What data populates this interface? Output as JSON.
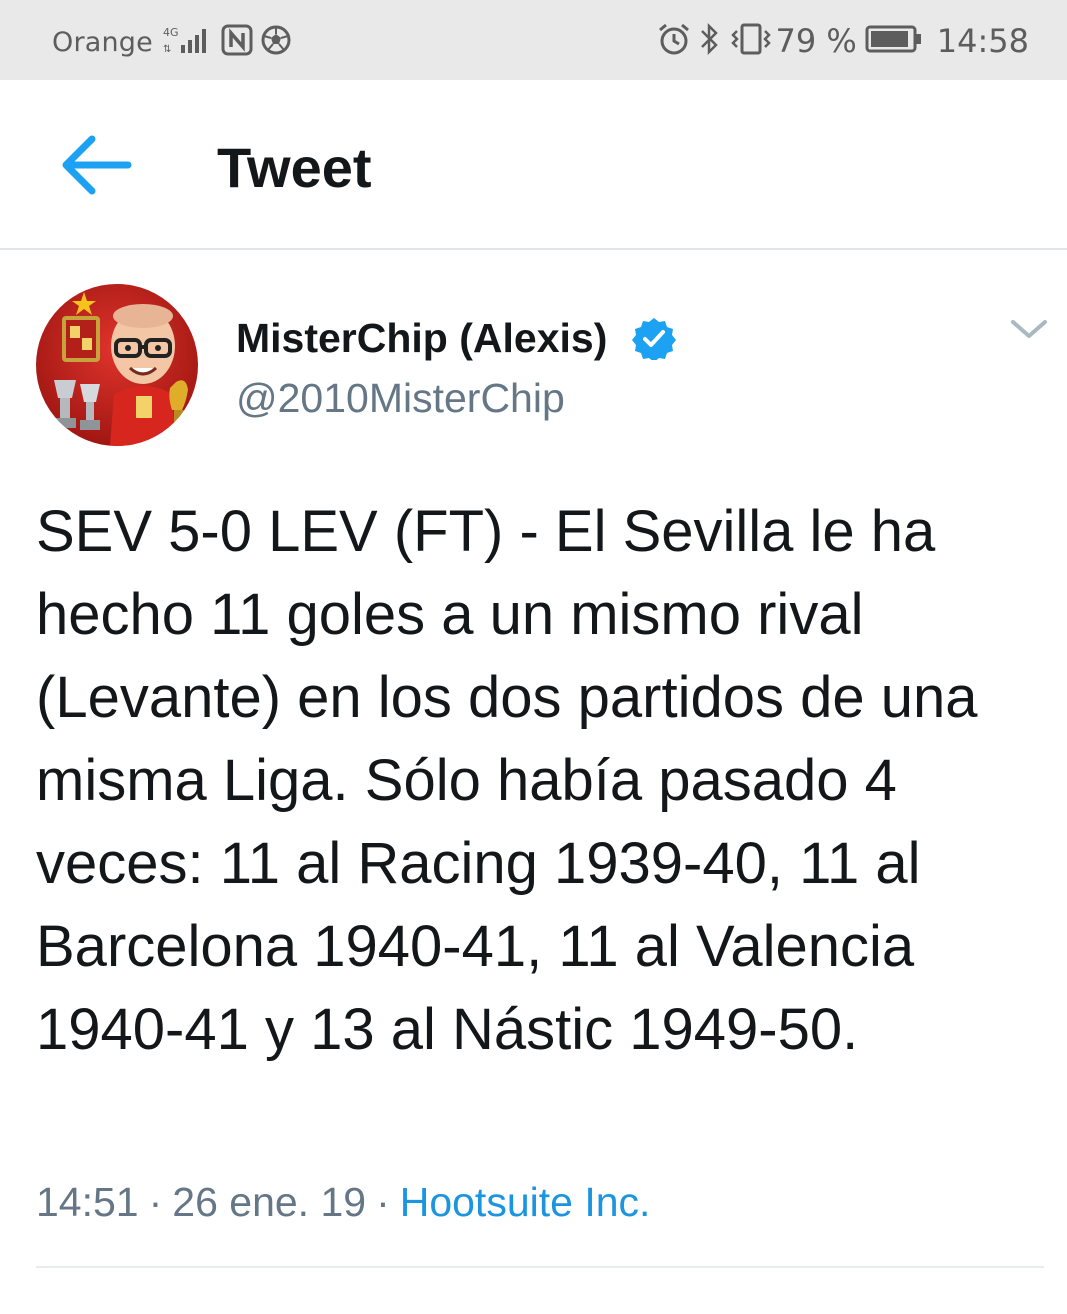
{
  "status_bar": {
    "carrier": "Orange",
    "network": "4G",
    "battery": "79 %",
    "time": "14:58",
    "icons": [
      "signal-icon",
      "nfc-icon",
      "football-app-icon",
      "alarm-icon",
      "bluetooth-icon",
      "vibrate-icon",
      "battery-icon"
    ]
  },
  "header": {
    "title": "Tweet",
    "back_icon": "back-arrow-icon",
    "accent_color": "#1da1f2"
  },
  "tweet": {
    "author": {
      "display_name": "MisterChip (Alexis)",
      "handle": "@2010MisterChip",
      "verified": true
    },
    "text": "SEV 5-0 LEV (FT) - El Sevilla le ha hecho 11 goles a un mismo rival (Levante) en los dos partidos de una misma Liga. Sólo había pasado 4 veces: 11 al Racing 1939-40, 11 al Barcelona 1940-41, 11 al Valencia 1940-41 y 13 al Nástic 1949-50.",
    "time": "14:51",
    "date": "26 ene. 19",
    "separator": "·",
    "source": "Hootsuite Inc."
  }
}
